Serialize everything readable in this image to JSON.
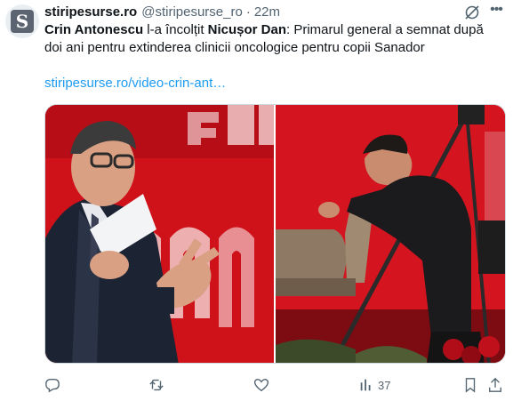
{
  "tweet": {
    "display_name": "stiripesurse.ro",
    "handle": "@stiripesurse_ro",
    "separator": "·",
    "time": "22m",
    "avatar_letter": "S",
    "text_part1": "Crin Antonescu",
    "text_part2": " l-a încolțit ",
    "text_part3": "Nicușor Dan",
    "text_part4": ": Primarul general a semnat după doi ani pentru extinderea clinicii oncologice pentru copii Sanador",
    "link": "stiripesurse.ro/video-crin-ant…",
    "views": "37"
  },
  "colors": {
    "link": "#1d9bf0",
    "secondary": "#536471",
    "cnn_red": "#d7141e"
  },
  "icons": [
    "grok-icon",
    "more-icon",
    "reply-icon",
    "retweet-icon",
    "like-icon",
    "views-icon",
    "bookmark-icon",
    "share-icon"
  ]
}
